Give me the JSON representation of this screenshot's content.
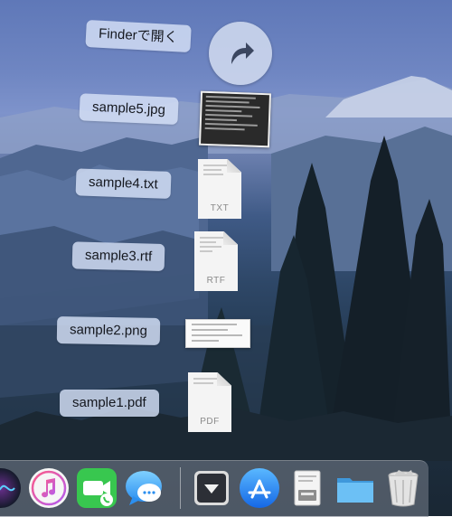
{
  "stack": {
    "open_label": "Finderで開く",
    "items": [
      {
        "name": "sample5.jpg"
      },
      {
        "name": "sample4.txt",
        "ext": "TXT"
      },
      {
        "name": "sample3.rtf",
        "ext": "RTF"
      },
      {
        "name": "sample2.png"
      },
      {
        "name": "sample1.pdf",
        "ext": "PDF"
      }
    ]
  },
  "dock": {
    "apps": [
      {
        "icon": "siri-icon"
      },
      {
        "icon": "itunes-icon"
      },
      {
        "icon": "facetime-icon"
      },
      {
        "icon": "messages-icon"
      },
      {
        "icon": "downloads-stack-icon"
      },
      {
        "icon": "app-store-icon"
      },
      {
        "icon": "preview-icon"
      },
      {
        "icon": "folder-icon"
      },
      {
        "icon": "trash-icon"
      }
    ]
  }
}
